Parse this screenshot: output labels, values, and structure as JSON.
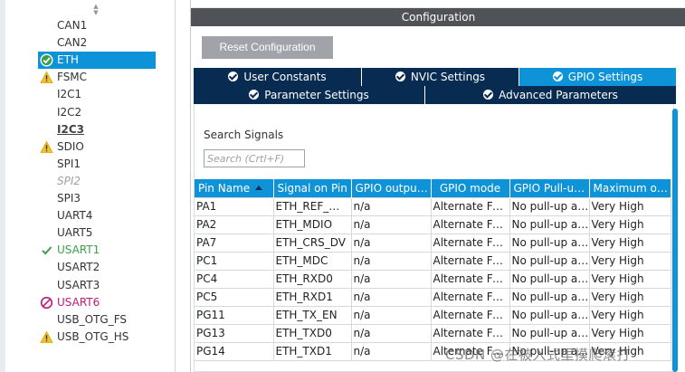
{
  "sidebar": {
    "items": [
      {
        "label": "CAN1",
        "state": "none"
      },
      {
        "label": "CAN2",
        "state": "none"
      },
      {
        "label": "ETH",
        "state": "selected-ok"
      },
      {
        "label": "FSMC",
        "state": "warning"
      },
      {
        "label": "I2C1",
        "state": "none"
      },
      {
        "label": "I2C2",
        "state": "none"
      },
      {
        "label": "I2C3",
        "state": "bold"
      },
      {
        "label": "SDIO",
        "state": "warning"
      },
      {
        "label": "SPI1",
        "state": "none"
      },
      {
        "label": "SPI2",
        "state": "disabled"
      },
      {
        "label": "SPI3",
        "state": "none"
      },
      {
        "label": "UART4",
        "state": "none"
      },
      {
        "label": "UART5",
        "state": "none"
      },
      {
        "label": "USART1",
        "state": "ok"
      },
      {
        "label": "USART2",
        "state": "none"
      },
      {
        "label": "USART3",
        "state": "none"
      },
      {
        "label": "USART6",
        "state": "blocked"
      },
      {
        "label": "USB_OTG_FS",
        "state": "none"
      },
      {
        "label": "USB_OTG_HS",
        "state": "warning"
      }
    ],
    "icons": {
      "ok": "check-circle-icon",
      "warning": "warning-triangle-icon",
      "blocked": "no-entry-icon",
      "sort": "sort-arrows-icon"
    }
  },
  "main": {
    "title": "Configuration",
    "reset_label": "Reset Configuration",
    "tabs_row1": [
      {
        "label": "User Constants",
        "active": false
      },
      {
        "label": "NVIC Settings",
        "active": false
      },
      {
        "label": "GPIO Settings",
        "active": true
      }
    ],
    "tabs_row2": [
      {
        "label": "Parameter Settings",
        "active": false
      },
      {
        "label": "Advanced Parameters",
        "active": false
      }
    ],
    "search": {
      "title": "Search Signals",
      "placeholder": "Search (Crtl+F)",
      "value": ""
    },
    "table": {
      "columns": [
        "Pin Name",
        "Signal on Pin",
        "GPIO output…",
        "GPIO mode",
        "GPIO Pull-u…",
        "Maximum o…"
      ],
      "rows": [
        [
          "PA1",
          "ETH_REF_…",
          "n/a",
          "Alternate Fu…",
          "No pull-up a…",
          "Very High"
        ],
        [
          "PA2",
          "ETH_MDIO",
          "n/a",
          "Alternate Fu…",
          "No pull-up a…",
          "Very High"
        ],
        [
          "PA7",
          "ETH_CRS_DV",
          "n/a",
          "Alternate Fu…",
          "No pull-up a…",
          "Very High"
        ],
        [
          "PC1",
          "ETH_MDC",
          "n/a",
          "Alternate Fu…",
          "No pull-up a…",
          "Very High"
        ],
        [
          "PC4",
          "ETH_RXD0",
          "n/a",
          "Alternate Fu…",
          "No pull-up a…",
          "Very High"
        ],
        [
          "PC5",
          "ETH_RXD1",
          "n/a",
          "Alternate Fu…",
          "No pull-up a…",
          "Very High"
        ],
        [
          "PG11",
          "ETH_TX_EN",
          "n/a",
          "Alternate Fu…",
          "No pull-up a…",
          "Very High"
        ],
        [
          "PG13",
          "ETH_TXD0",
          "n/a",
          "Alternate Fu…",
          "No pull-up a…",
          "Very High"
        ],
        [
          "PG14",
          "ETH_TXD1",
          "n/a",
          "Alternate Fu…",
          "No pull-up a…",
          "Very High"
        ]
      ]
    }
  },
  "watermark": "CSDN @在被入式里摸爬滚打",
  "colors": {
    "accent": "#0f93d8",
    "tab_dark": "#082b52",
    "title_bar": "#4f5257",
    "ok": "#3aa04b",
    "warning": "#f2c12e",
    "blocked": "#c2187a"
  }
}
